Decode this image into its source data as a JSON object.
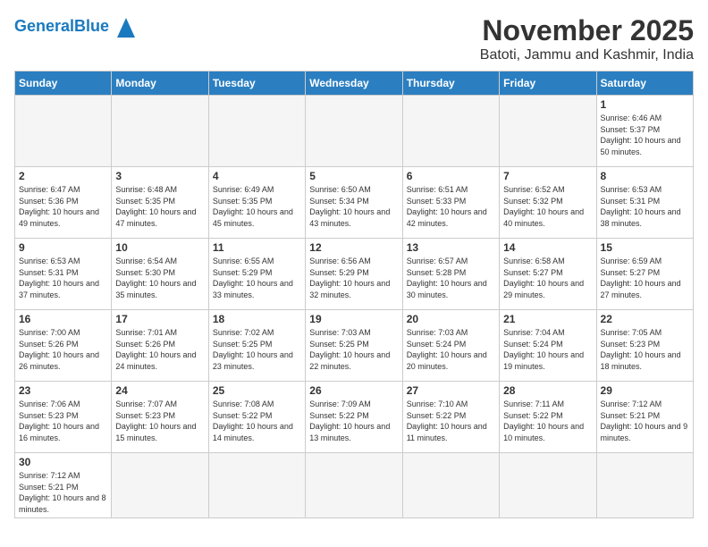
{
  "header": {
    "logo_text_general": "General",
    "logo_text_blue": "Blue",
    "month_title": "November 2025",
    "location": "Batoti, Jammu and Kashmir, India"
  },
  "weekdays": [
    "Sunday",
    "Monday",
    "Tuesday",
    "Wednesday",
    "Thursday",
    "Friday",
    "Saturday"
  ],
  "weeks": [
    [
      {
        "day": "",
        "info": ""
      },
      {
        "day": "",
        "info": ""
      },
      {
        "day": "",
        "info": ""
      },
      {
        "day": "",
        "info": ""
      },
      {
        "day": "",
        "info": ""
      },
      {
        "day": "",
        "info": ""
      },
      {
        "day": "1",
        "info": "Sunrise: 6:46 AM\nSunset: 5:37 PM\nDaylight: 10 hours\nand 50 minutes."
      }
    ],
    [
      {
        "day": "2",
        "info": "Sunrise: 6:47 AM\nSunset: 5:36 PM\nDaylight: 10 hours\nand 49 minutes."
      },
      {
        "day": "3",
        "info": "Sunrise: 6:48 AM\nSunset: 5:35 PM\nDaylight: 10 hours\nand 47 minutes."
      },
      {
        "day": "4",
        "info": "Sunrise: 6:49 AM\nSunset: 5:35 PM\nDaylight: 10 hours\nand 45 minutes."
      },
      {
        "day": "5",
        "info": "Sunrise: 6:50 AM\nSunset: 5:34 PM\nDaylight: 10 hours\nand 43 minutes."
      },
      {
        "day": "6",
        "info": "Sunrise: 6:51 AM\nSunset: 5:33 PM\nDaylight: 10 hours\nand 42 minutes."
      },
      {
        "day": "7",
        "info": "Sunrise: 6:52 AM\nSunset: 5:32 PM\nDaylight: 10 hours\nand 40 minutes."
      },
      {
        "day": "8",
        "info": "Sunrise: 6:53 AM\nSunset: 5:31 PM\nDaylight: 10 hours\nand 38 minutes."
      }
    ],
    [
      {
        "day": "9",
        "info": "Sunrise: 6:53 AM\nSunset: 5:31 PM\nDaylight: 10 hours\nand 37 minutes."
      },
      {
        "day": "10",
        "info": "Sunrise: 6:54 AM\nSunset: 5:30 PM\nDaylight: 10 hours\nand 35 minutes."
      },
      {
        "day": "11",
        "info": "Sunrise: 6:55 AM\nSunset: 5:29 PM\nDaylight: 10 hours\nand 33 minutes."
      },
      {
        "day": "12",
        "info": "Sunrise: 6:56 AM\nSunset: 5:29 PM\nDaylight: 10 hours\nand 32 minutes."
      },
      {
        "day": "13",
        "info": "Sunrise: 6:57 AM\nSunset: 5:28 PM\nDaylight: 10 hours\nand 30 minutes."
      },
      {
        "day": "14",
        "info": "Sunrise: 6:58 AM\nSunset: 5:27 PM\nDaylight: 10 hours\nand 29 minutes."
      },
      {
        "day": "15",
        "info": "Sunrise: 6:59 AM\nSunset: 5:27 PM\nDaylight: 10 hours\nand 27 minutes."
      }
    ],
    [
      {
        "day": "16",
        "info": "Sunrise: 7:00 AM\nSunset: 5:26 PM\nDaylight: 10 hours\nand 26 minutes."
      },
      {
        "day": "17",
        "info": "Sunrise: 7:01 AM\nSunset: 5:26 PM\nDaylight: 10 hours\nand 24 minutes."
      },
      {
        "day": "18",
        "info": "Sunrise: 7:02 AM\nSunset: 5:25 PM\nDaylight: 10 hours\nand 23 minutes."
      },
      {
        "day": "19",
        "info": "Sunrise: 7:03 AM\nSunset: 5:25 PM\nDaylight: 10 hours\nand 22 minutes."
      },
      {
        "day": "20",
        "info": "Sunrise: 7:03 AM\nSunset: 5:24 PM\nDaylight: 10 hours\nand 20 minutes."
      },
      {
        "day": "21",
        "info": "Sunrise: 7:04 AM\nSunset: 5:24 PM\nDaylight: 10 hours\nand 19 minutes."
      },
      {
        "day": "22",
        "info": "Sunrise: 7:05 AM\nSunset: 5:23 PM\nDaylight: 10 hours\nand 18 minutes."
      }
    ],
    [
      {
        "day": "23",
        "info": "Sunrise: 7:06 AM\nSunset: 5:23 PM\nDaylight: 10 hours\nand 16 minutes."
      },
      {
        "day": "24",
        "info": "Sunrise: 7:07 AM\nSunset: 5:23 PM\nDaylight: 10 hours\nand 15 minutes."
      },
      {
        "day": "25",
        "info": "Sunrise: 7:08 AM\nSunset: 5:22 PM\nDaylight: 10 hours\nand 14 minutes."
      },
      {
        "day": "26",
        "info": "Sunrise: 7:09 AM\nSunset: 5:22 PM\nDaylight: 10 hours\nand 13 minutes."
      },
      {
        "day": "27",
        "info": "Sunrise: 7:10 AM\nSunset: 5:22 PM\nDaylight: 10 hours\nand 11 minutes."
      },
      {
        "day": "28",
        "info": "Sunrise: 7:11 AM\nSunset: 5:22 PM\nDaylight: 10 hours\nand 10 minutes."
      },
      {
        "day": "29",
        "info": "Sunrise: 7:12 AM\nSunset: 5:21 PM\nDaylight: 10 hours\nand 9 minutes."
      }
    ],
    [
      {
        "day": "30",
        "info": "Sunrise: 7:12 AM\nSunset: 5:21 PM\nDaylight: 10 hours\nand 8 minutes."
      },
      {
        "day": "",
        "info": ""
      },
      {
        "day": "",
        "info": ""
      },
      {
        "day": "",
        "info": ""
      },
      {
        "day": "",
        "info": ""
      },
      {
        "day": "",
        "info": ""
      },
      {
        "day": "",
        "info": ""
      }
    ]
  ]
}
